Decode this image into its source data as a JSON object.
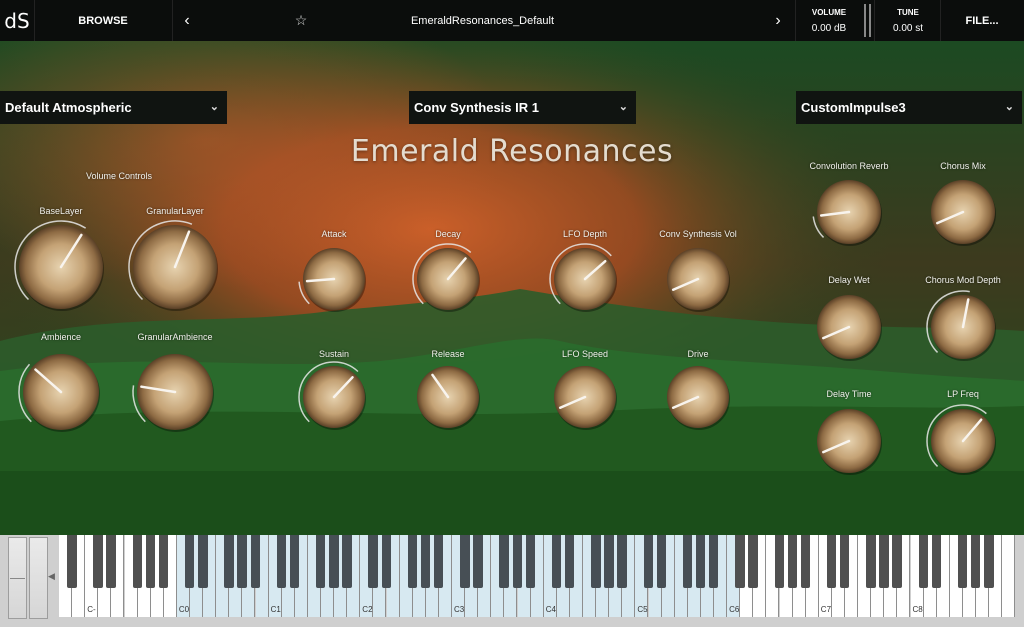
{
  "header": {
    "logo": "dS",
    "browse_label": "BROWSE",
    "preset_name": "EmeraldResonances_Default",
    "volume_label": "VOLUME",
    "volume_value": "0.00 dB",
    "tune_label": "TUNE",
    "tune_value": "0.00 st",
    "file_label": "FILE..."
  },
  "title": "Emerald Resonances",
  "dropdowns": {
    "left": "Default Atmospheric",
    "center": "Conv Synthesis IR 1",
    "right": "CustomImpulse3"
  },
  "section_label": "Volume Controls",
  "knobs": [
    {
      "id": "baselayer",
      "label": "BaseLayer",
      "value": 0.62,
      "arc": true
    },
    {
      "id": "granularlayer",
      "label": "GranularLayer",
      "value": 0.58,
      "arc": true
    },
    {
      "id": "ambience",
      "label": "Ambience",
      "value": 0.32,
      "arc": true
    },
    {
      "id": "granularambience",
      "label": "GranularAmbience",
      "value": 0.2,
      "arc": true
    },
    {
      "id": "attack",
      "label": "Attack",
      "value": 0.15,
      "arc": true
    },
    {
      "id": "decay",
      "label": "Decay",
      "value": 0.65,
      "arc": true
    },
    {
      "id": "lfo-depth",
      "label": "LFO Depth",
      "value": 0.68,
      "arc": true
    },
    {
      "id": "conv-synthesis-vol",
      "label": "Conv Synthesis Vol",
      "value": 0.08,
      "arc": false
    },
    {
      "id": "sustain",
      "label": "Sustain",
      "value": 0.66,
      "arc": true
    },
    {
      "id": "release",
      "label": "Release",
      "value": 0.37,
      "arc": false
    },
    {
      "id": "lfo-speed",
      "label": "LFO Speed",
      "value": 0.08,
      "arc": false
    },
    {
      "id": "drive",
      "label": "Drive",
      "value": 0.08,
      "arc": false
    },
    {
      "id": "convolution-reverb",
      "label": "Convolution Reverb",
      "value": 0.14,
      "arc": true
    },
    {
      "id": "chorus-mix",
      "label": "Chorus Mix",
      "value": 0.08,
      "arc": false
    },
    {
      "id": "delay-wet",
      "label": "Delay Wet",
      "value": 0.08,
      "arc": false
    },
    {
      "id": "chorus-mod-depth",
      "label": "Chorus Mod Depth",
      "value": 0.54,
      "arc": true
    },
    {
      "id": "delay-time",
      "label": "Delay Time",
      "value": 0.08,
      "arc": false
    },
    {
      "id": "lp-freq",
      "label": "LP Freq",
      "value": 0.65,
      "arc": true
    }
  ],
  "keyboard": {
    "octave_labels": [
      "C-",
      "C0",
      "C1",
      "C2",
      "C3",
      "C4",
      "C5",
      "C6",
      "C7",
      "C8"
    ],
    "active_range": "C0–C6"
  },
  "colors": {
    "header_bg": "#0b0d0c",
    "sky_orange": "#c65a26",
    "hills_green": "#2f6b2b",
    "knob_gold": "#c9a97c",
    "active_key": "#d7e9f1"
  }
}
